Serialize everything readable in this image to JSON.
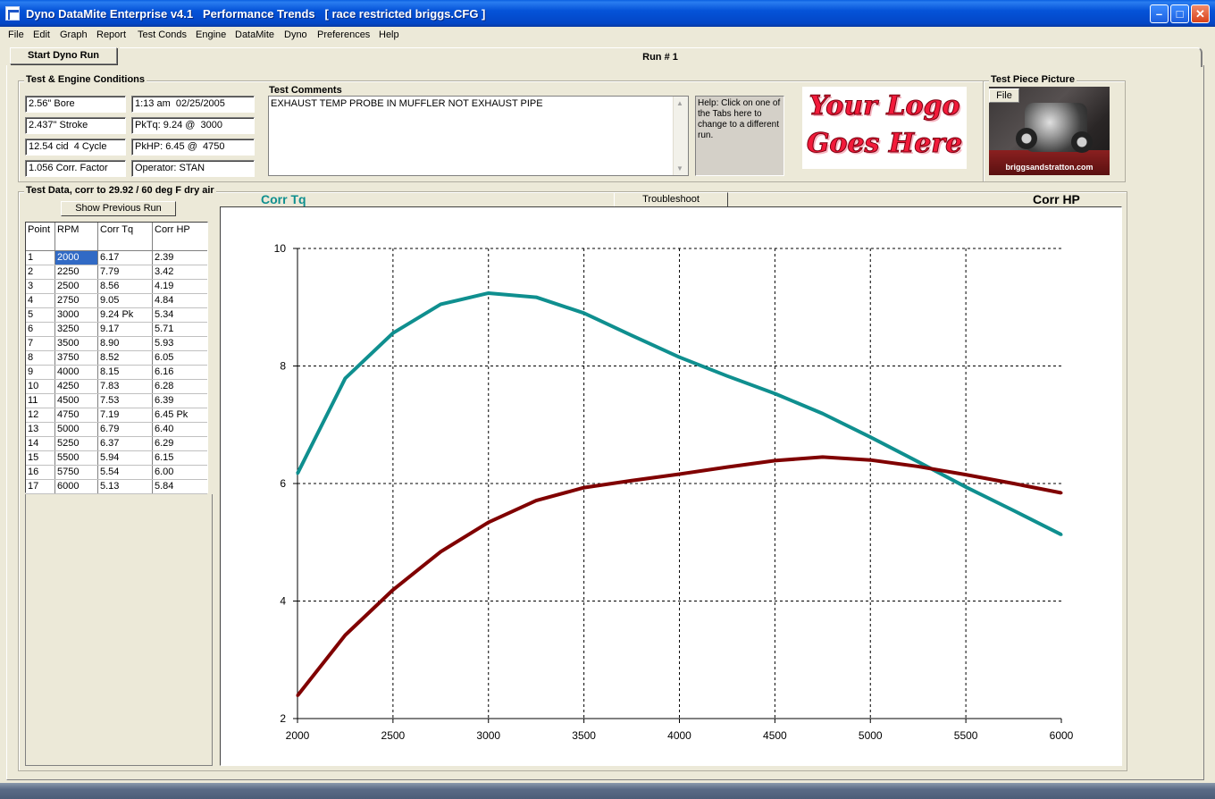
{
  "window": {
    "title": "Dyno DataMite Enterprise v4.1   Performance Trends   [ race restricted briggs.CFG ]",
    "min": "–",
    "max": "□",
    "close": "✕"
  },
  "menu": [
    {
      "label": "File"
    },
    {
      "label": "Edit"
    },
    {
      "label": "Graph"
    },
    {
      "label": "Report"
    },
    {
      "label": "Test Conds"
    },
    {
      "label": "Engine"
    },
    {
      "label": "DataMite"
    },
    {
      "label": "Dyno"
    },
    {
      "label": "Preferences"
    },
    {
      "label": "Help"
    }
  ],
  "tabs": {
    "start_button": "Start Dyno Run",
    "run_tab": "Run # 1"
  },
  "conditions": {
    "title": "Test & Engine Conditions",
    "bore": "2.56\" Bore",
    "stroke": "2.437\" Stroke",
    "cid": "12.54 cid  4 Cycle",
    "corr_factor": "1.056 Corr. Factor",
    "datetime": "1:13 am  02/25/2005",
    "pk_tq": "PkTq: 9.24 @  3000",
    "pk_hp": "PkHP: 6.45 @  4750",
    "operator": "Operator: STAN"
  },
  "comments": {
    "title": "Test Comments",
    "text": "EXHAUST TEMP PROBE IN MUFFLER NOT EXHAUST PIPE"
  },
  "help": {
    "text": "Help:  Click on one of the Tabs here to change to a different run."
  },
  "logo": {
    "line1": "Your Logo",
    "line2": "Goes Here"
  },
  "picture": {
    "title": "Test Piece Picture",
    "file_button": "File",
    "caption": "briggsandstratton.com"
  },
  "test_data": {
    "title": "Test Data, corr to 29.92 / 60 deg F dry air",
    "show_prev": "Show Previous Run",
    "headers": [
      "Point",
      "RPM",
      "Corr Tq",
      "Corr HP"
    ],
    "rows": [
      [
        "1",
        "2000",
        "6.17",
        "2.39"
      ],
      [
        "2",
        "2250",
        "7.79",
        "3.42"
      ],
      [
        "3",
        "2500",
        "8.56",
        "4.19"
      ],
      [
        "4",
        "2750",
        "9.05",
        "4.84"
      ],
      [
        "5",
        "3000",
        "9.24 Pk",
        "5.34"
      ],
      [
        "6",
        "3250",
        "9.17",
        "5.71"
      ],
      [
        "7",
        "3500",
        "8.90",
        "5.93"
      ],
      [
        "8",
        "3750",
        "8.52",
        "6.05"
      ],
      [
        "9",
        "4000",
        "8.15",
        "6.16"
      ],
      [
        "10",
        "4250",
        "7.83",
        "6.28"
      ],
      [
        "11",
        "4500",
        "7.53",
        "6.39"
      ],
      [
        "12",
        "4750",
        "7.19",
        "6.45 Pk"
      ],
      [
        "13",
        "5000",
        "6.79",
        "6.40"
      ],
      [
        "14",
        "5250",
        "6.37",
        "6.29"
      ],
      [
        "15",
        "5500",
        "5.94",
        "6.15"
      ],
      [
        "16",
        "5750",
        "5.54",
        "6.00"
      ],
      [
        "17",
        "6000",
        "5.13",
        "5.84"
      ]
    ]
  },
  "graph": {
    "troubleshoot": "Troubleshoot",
    "left_label": "Corr Tq",
    "right_label": "Corr HP"
  },
  "chart_data": {
    "type": "line",
    "x": [
      2000,
      2250,
      2500,
      2750,
      3000,
      3250,
      3500,
      3750,
      4000,
      4250,
      4500,
      4750,
      5000,
      5250,
      5500,
      5750,
      6000
    ],
    "series": [
      {
        "name": "Corr Tq",
        "color": "#0f8f8f",
        "values": [
          6.17,
          7.79,
          8.56,
          9.05,
          9.24,
          9.17,
          8.9,
          8.52,
          8.15,
          7.83,
          7.53,
          7.19,
          6.79,
          6.37,
          5.94,
          5.54,
          5.13
        ]
      },
      {
        "name": "Corr HP",
        "color": "#800000",
        "values": [
          2.39,
          3.42,
          4.19,
          4.84,
          5.34,
          5.71,
          5.93,
          6.05,
          6.16,
          6.28,
          6.39,
          6.45,
          6.4,
          6.29,
          6.15,
          6.0,
          5.84
        ]
      }
    ],
    "xlim": [
      2000,
      6000
    ],
    "ylim": [
      2,
      10
    ],
    "xticks": [
      "2000",
      "2500",
      "3000",
      "3500",
      "4000",
      "4500",
      "5000",
      "5500",
      "6000"
    ],
    "yticks": [
      "2",
      "4",
      "6",
      "8",
      "10"
    ],
    "grid": true
  }
}
